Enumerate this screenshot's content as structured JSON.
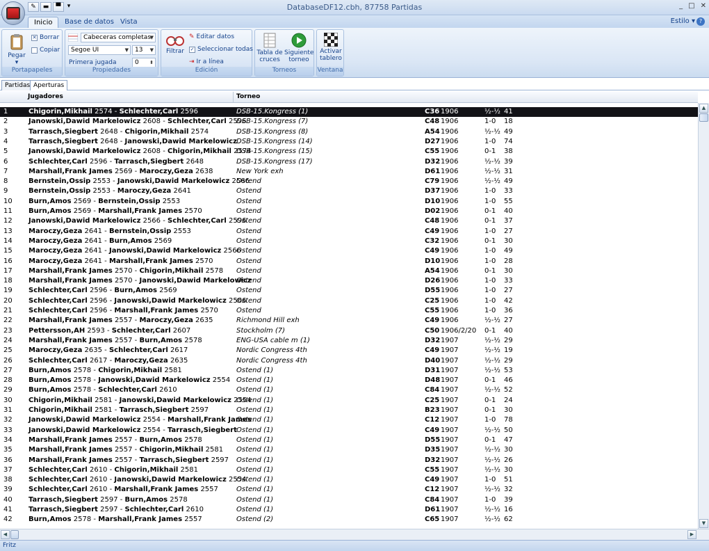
{
  "window": {
    "title": "DatabaseDF12.cbh, 87758 Partidas",
    "controls": [
      "_",
      "□",
      "✕"
    ]
  },
  "ribbon_tabs": [
    "Inicio",
    "Base de datos",
    "Vista"
  ],
  "style_menu": "Estilo",
  "ribbon": {
    "portapapeles": {
      "label": "Portapapeles",
      "paste": "Pegar",
      "delete": "Borrar",
      "copy": "Copiar"
    },
    "propiedades": {
      "label": "Propiedades",
      "header_mode": "Cabeceras completas",
      "font": "Segoe UI",
      "size": "13",
      "first_move_label": "Primera jugada",
      "first_move_value": "0"
    },
    "edicion": {
      "label": "Edición",
      "filter": "Filtrar",
      "edit": "Editar datos",
      "select_all": "Seleccionar todas",
      "goto_line": "Ir a línea"
    },
    "torneos": {
      "label": "Torneos",
      "crosstable": "Tabla de cruces",
      "next": "Siguiente torneo"
    },
    "ventana": {
      "label": "Ventana",
      "board": "Activar tablero"
    }
  },
  "subtabs": [
    "Partidas",
    "Aperturas"
  ],
  "columns": {
    "players": "Jugadores",
    "tournament": "Torneo"
  },
  "status": "Fritz",
  "rows": [
    {
      "n": "1",
      "w": "Chigorin,Mikhail",
      "we": "2574",
      "b": "Schlechter,Carl",
      "be": "2596",
      "t": "DSB-15.Kongress (1)",
      "eco": "C36",
      "y": "1906",
      "r": "½-½",
      "m": "41"
    },
    {
      "n": "2",
      "w": "Janowski,Dawid Markelowicz",
      "we": "2608",
      "b": "Schlechter,Carl",
      "be": "2596",
      "t": "DSB-15.Kongress (7)",
      "eco": "C48",
      "y": "1906",
      "r": "1-0",
      "m": "18"
    },
    {
      "n": "3",
      "w": "Tarrasch,Siegbert",
      "we": "2648",
      "b": "Chigorin,Mikhail",
      "be": "2574",
      "t": "DSB-15.Kongress (8)",
      "eco": "A54",
      "y": "1906",
      "r": "½-½",
      "m": "49"
    },
    {
      "n": "4",
      "w": "Tarrasch,Siegbert",
      "we": "2648",
      "b": "Janowski,Dawid Markelowicz",
      "be": "",
      "t": "DSB-15.Kongress (14)",
      "eco": "D27",
      "y": "1906",
      "r": "1-0",
      "m": "74"
    },
    {
      "n": "5",
      "w": "Janowski,Dawid Markelowicz",
      "we": "2608",
      "b": "Chigorin,Mikhail",
      "be": "2574",
      "t": "DSB-15.Kongress (15)",
      "eco": "C55",
      "y": "1906",
      "r": "0-1",
      "m": "38"
    },
    {
      "n": "6",
      "w": "Schlechter,Carl",
      "we": "2596",
      "b": "Tarrasch,Siegbert",
      "be": "2648",
      "t": "DSB-15.Kongress (17)",
      "eco": "D32",
      "y": "1906",
      "r": "½-½",
      "m": "39"
    },
    {
      "n": "7",
      "w": "Marshall,Frank James",
      "we": "2569",
      "b": "Maroczy,Geza",
      "be": "2638",
      "t": "New York exh",
      "eco": "D61",
      "y": "1906",
      "r": "½-½",
      "m": "31"
    },
    {
      "n": "8",
      "w": "Bernstein,Ossip",
      "we": "2553",
      "b": "Janowski,Dawid Markelowicz",
      "be": "2566",
      "t": "Ostend",
      "eco": "C79",
      "y": "1906",
      "r": "½-½",
      "m": "49"
    },
    {
      "n": "9",
      "w": "Bernstein,Ossip",
      "we": "2553",
      "b": "Maroczy,Geza",
      "be": "2641",
      "t": "Ostend",
      "eco": "D37",
      "y": "1906",
      "r": "1-0",
      "m": "33"
    },
    {
      "n": "10",
      "w": "Burn,Amos",
      "we": "2569",
      "b": "Bernstein,Ossip",
      "be": "2553",
      "t": "Ostend",
      "eco": "D10",
      "y": "1906",
      "r": "1-0",
      "m": "55"
    },
    {
      "n": "11",
      "w": "Burn,Amos",
      "we": "2569",
      "b": "Marshall,Frank James",
      "be": "2570",
      "t": "Ostend",
      "eco": "D02",
      "y": "1906",
      "r": "0-1",
      "m": "40"
    },
    {
      "n": "12",
      "w": "Janowski,Dawid Markelowicz",
      "we": "2566",
      "b": "Schlechter,Carl",
      "be": "2596",
      "t": "Ostend",
      "eco": "C48",
      "y": "1906",
      "r": "0-1",
      "m": "37"
    },
    {
      "n": "13",
      "w": "Maroczy,Geza",
      "we": "2641",
      "b": "Bernstein,Ossip",
      "be": "2553",
      "t": "Ostend",
      "eco": "C49",
      "y": "1906",
      "r": "1-0",
      "m": "27"
    },
    {
      "n": "14",
      "w": "Maroczy,Geza",
      "we": "2641",
      "b": "Burn,Amos",
      "be": "2569",
      "t": "Ostend",
      "eco": "C32",
      "y": "1906",
      "r": "0-1",
      "m": "30"
    },
    {
      "n": "15",
      "w": "Maroczy,Geza",
      "we": "2641",
      "b": "Janowski,Dawid Markelowicz",
      "be": "2566",
      "t": "Ostend",
      "eco": "C49",
      "y": "1906",
      "r": "1-0",
      "m": "49"
    },
    {
      "n": "16",
      "w": "Maroczy,Geza",
      "we": "2641",
      "b": "Marshall,Frank James",
      "be": "2570",
      "t": "Ostend",
      "eco": "D10",
      "y": "1906",
      "r": "1-0",
      "m": "28"
    },
    {
      "n": "17",
      "w": "Marshall,Frank James",
      "we": "2570",
      "b": "Chigorin,Mikhail",
      "be": "2578",
      "t": "Ostend",
      "eco": "A54",
      "y": "1906",
      "r": "0-1",
      "m": "30"
    },
    {
      "n": "18",
      "w": "Marshall,Frank James",
      "we": "2570",
      "b": "Janowski,Dawid Markelowicz",
      "be": "",
      "t": "Ostend",
      "eco": "D26",
      "y": "1906",
      "r": "1-0",
      "m": "33"
    },
    {
      "n": "19",
      "w": "Schlechter,Carl",
      "we": "2596",
      "b": "Burn,Amos",
      "be": "2569",
      "t": "Ostend",
      "eco": "D55",
      "y": "1906",
      "r": "1-0",
      "m": "27"
    },
    {
      "n": "20",
      "w": "Schlechter,Carl",
      "we": "2596",
      "b": "Janowski,Dawid Markelowicz",
      "be": "2566",
      "t": "Ostend",
      "eco": "C25",
      "y": "1906",
      "r": "1-0",
      "m": "42"
    },
    {
      "n": "21",
      "w": "Schlechter,Carl",
      "we": "2596",
      "b": "Marshall,Frank James",
      "be": "2570",
      "t": "Ostend",
      "eco": "C55",
      "y": "1906",
      "r": "1-0",
      "m": "36"
    },
    {
      "n": "22",
      "w": "Marshall,Frank James",
      "we": "2557",
      "b": "Maroczy,Geza",
      "be": "2635",
      "t": "Richmond Hill exh",
      "eco": "C49",
      "y": "1906",
      "r": "½-½",
      "m": "27"
    },
    {
      "n": "23",
      "w": "Pettersson,AH",
      "we": "2593",
      "b": "Schlechter,Carl",
      "be": "2607",
      "t": "Stockholm (7)",
      "eco": "C50",
      "y": "1906/2/20",
      "r": "0-1",
      "m": "40"
    },
    {
      "n": "24",
      "w": "Marshall,Frank James",
      "we": "2557",
      "b": "Burn,Amos",
      "be": "2578",
      "t": "ENG-USA cable m (1)",
      "eco": "D32",
      "y": "1907",
      "r": "½-½",
      "m": "29"
    },
    {
      "n": "25",
      "w": "Maroczy,Geza",
      "we": "2635",
      "b": "Schlechter,Carl",
      "be": "2617",
      "t": "Nordic Congress 4th",
      "eco": "C49",
      "y": "1907",
      "r": "½-½",
      "m": "19"
    },
    {
      "n": "26",
      "w": "Schlechter,Carl",
      "we": "2617",
      "b": "Maroczy,Geza",
      "be": "2635",
      "t": "Nordic Congress 4th",
      "eco": "D40",
      "y": "1907",
      "r": "½-½",
      "m": "29"
    },
    {
      "n": "27",
      "w": "Burn,Amos",
      "we": "2578",
      "b": "Chigorin,Mikhail",
      "be": "2581",
      "t": "Ostend (1)",
      "eco": "D31",
      "y": "1907",
      "r": "½-½",
      "m": "53"
    },
    {
      "n": "28",
      "w": "Burn,Amos",
      "we": "2578",
      "b": "Janowski,Dawid Markelowicz",
      "be": "2554",
      "t": "Ostend (1)",
      "eco": "D48",
      "y": "1907",
      "r": "0-1",
      "m": "46"
    },
    {
      "n": "29",
      "w": "Burn,Amos",
      "we": "2578",
      "b": "Schlechter,Carl",
      "be": "2610",
      "t": "Ostend (1)",
      "eco": "C84",
      "y": "1907",
      "r": "½-½",
      "m": "52"
    },
    {
      "n": "30",
      "w": "Chigorin,Mikhail",
      "we": "2581",
      "b": "Janowski,Dawid Markelowicz",
      "be": "2554",
      "t": "Ostend (1)",
      "eco": "C25",
      "y": "1907",
      "r": "0-1",
      "m": "24"
    },
    {
      "n": "31",
      "w": "Chigorin,Mikhail",
      "we": "2581",
      "b": "Tarrasch,Siegbert",
      "be": "2597",
      "t": "Ostend (1)",
      "eco": "B23",
      "y": "1907",
      "r": "0-1",
      "m": "30"
    },
    {
      "n": "32",
      "w": "Janowski,Dawid Markelowicz",
      "we": "2554",
      "b": "Marshall,Frank James",
      "be": "",
      "t": "Ostend (1)",
      "eco": "C12",
      "y": "1907",
      "r": "1-0",
      "m": "78"
    },
    {
      "n": "33",
      "w": "Janowski,Dawid Markelowicz",
      "we": "2554",
      "b": "Tarrasch,Siegbert",
      "be": "",
      "t": "Ostend (1)",
      "eco": "C49",
      "y": "1907",
      "r": "½-½",
      "m": "50"
    },
    {
      "n": "34",
      "w": "Marshall,Frank James",
      "we": "2557",
      "b": "Burn,Amos",
      "be": "2578",
      "t": "Ostend (1)",
      "eco": "D55",
      "y": "1907",
      "r": "0-1",
      "m": "47"
    },
    {
      "n": "35",
      "w": "Marshall,Frank James",
      "we": "2557",
      "b": "Chigorin,Mikhail",
      "be": "2581",
      "t": "Ostend (1)",
      "eco": "D35",
      "y": "1907",
      "r": "½-½",
      "m": "30"
    },
    {
      "n": "36",
      "w": "Marshall,Frank James",
      "we": "2557",
      "b": "Tarrasch,Siegbert",
      "be": "2597",
      "t": "Ostend (1)",
      "eco": "D32",
      "y": "1907",
      "r": "½-½",
      "m": "26"
    },
    {
      "n": "37",
      "w": "Schlechter,Carl",
      "we": "2610",
      "b": "Chigorin,Mikhail",
      "be": "2581",
      "t": "Ostend (1)",
      "eco": "C55",
      "y": "1907",
      "r": "½-½",
      "m": "30"
    },
    {
      "n": "38",
      "w": "Schlechter,Carl",
      "we": "2610",
      "b": "Janowski,Dawid Markelowicz",
      "be": "2554",
      "t": "Ostend (1)",
      "eco": "C49",
      "y": "1907",
      "r": "1-0",
      "m": "51"
    },
    {
      "n": "39",
      "w": "Schlechter,Carl",
      "we": "2610",
      "b": "Marshall,Frank James",
      "be": "2557",
      "t": "Ostend (1)",
      "eco": "C12",
      "y": "1907",
      "r": "½-½",
      "m": "32"
    },
    {
      "n": "40",
      "w": "Tarrasch,Siegbert",
      "we": "2597",
      "b": "Burn,Amos",
      "be": "2578",
      "t": "Ostend (1)",
      "eco": "C84",
      "y": "1907",
      "r": "1-0",
      "m": "39"
    },
    {
      "n": "41",
      "w": "Tarrasch,Siegbert",
      "we": "2597",
      "b": "Schlechter,Carl",
      "be": "2610",
      "t": "Ostend (1)",
      "eco": "D61",
      "y": "1907",
      "r": "½-½",
      "m": "16"
    },
    {
      "n": "42",
      "w": "Burn,Amos",
      "we": "2578",
      "b": "Marshall,Frank James",
      "be": "2557",
      "t": "Ostend (2)",
      "eco": "C65",
      "y": "1907",
      "r": "½-½",
      "m": "62"
    }
  ]
}
